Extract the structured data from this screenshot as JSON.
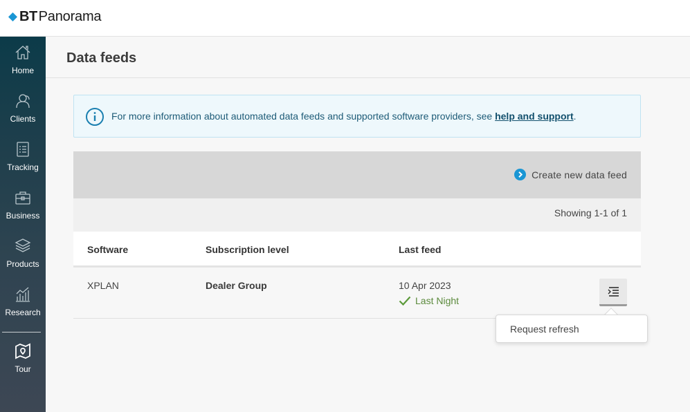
{
  "header": {
    "logo_bt": "BT",
    "logo_name": "Panorama"
  },
  "sidebar": {
    "items": [
      {
        "label": "Home",
        "icon": "home-icon"
      },
      {
        "label": "Clients",
        "icon": "clients-icon"
      },
      {
        "label": "Tracking",
        "icon": "tracking-icon"
      },
      {
        "label": "Business",
        "icon": "briefcase-icon"
      },
      {
        "label": "Products",
        "icon": "layers-icon"
      },
      {
        "label": "Research",
        "icon": "chart-icon"
      },
      {
        "label": "Tour",
        "icon": "map-icon"
      }
    ]
  },
  "page": {
    "title": "Data feeds"
  },
  "info_banner": {
    "text": "For more information about automated data feeds and supported software providers, see ",
    "link": "help and support",
    "suffix": "."
  },
  "actions": {
    "create_label": "Create new data feed"
  },
  "results": {
    "showing": "Showing 1-1 of 1"
  },
  "table": {
    "headers": [
      "Software",
      "Subscription level",
      "Last feed"
    ],
    "rows": [
      {
        "software": "XPLAN",
        "subscription": "Dealer Group",
        "last_feed_date": "10 Apr 2023",
        "status": "Last Night"
      }
    ]
  },
  "row_menu": {
    "items": [
      "Request refresh"
    ]
  },
  "colors": {
    "brand_blue": "#1a96d4",
    "status_green": "#5b8a3c",
    "info_text": "#1d5b77"
  }
}
